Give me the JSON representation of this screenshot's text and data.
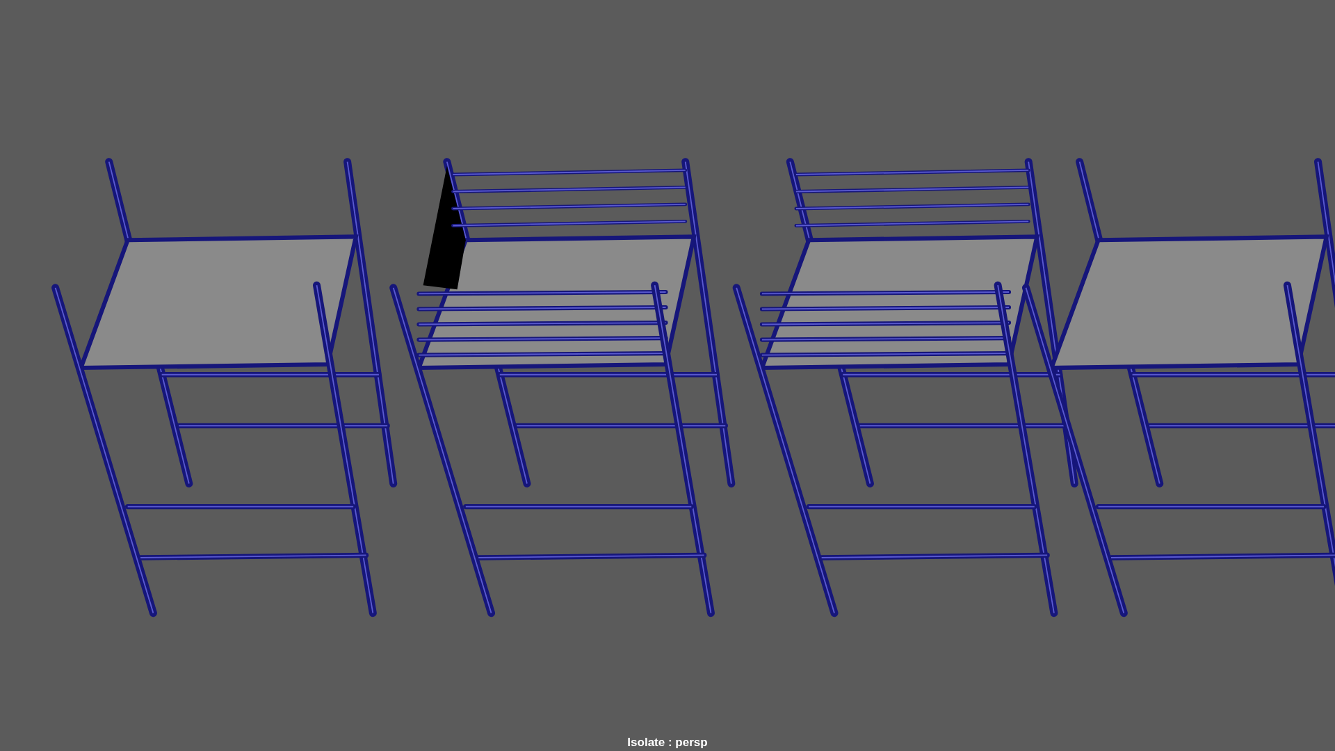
{
  "viewport": {
    "label": "Isolate : persp"
  }
}
